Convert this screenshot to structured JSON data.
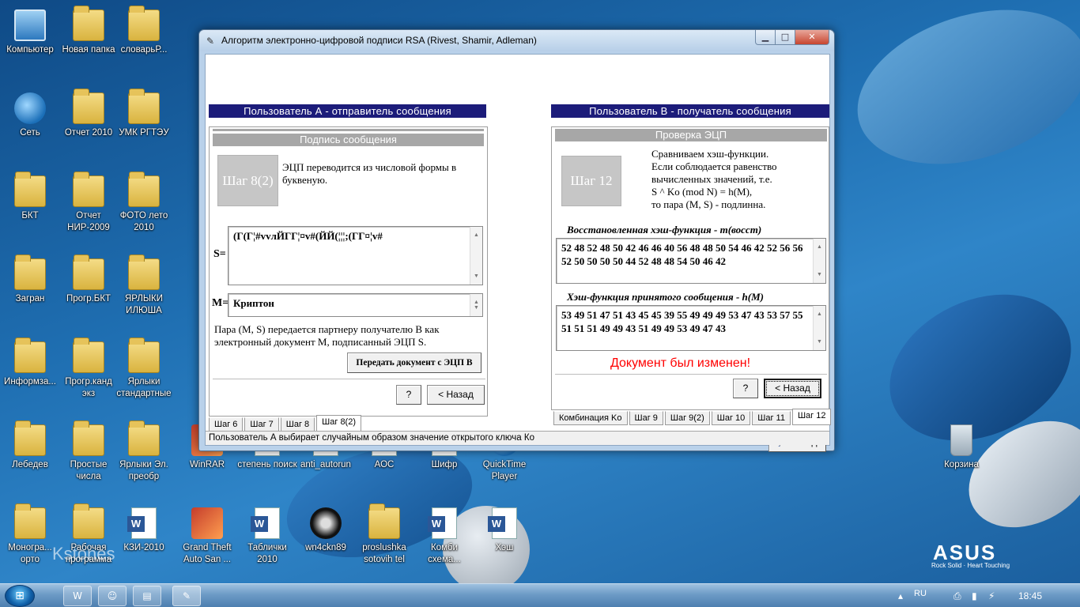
{
  "desktop": {
    "icons": [
      {
        "label": "Компьютер",
        "icon": "computer-icon"
      },
      {
        "label": "Новая папка",
        "icon": "folder-icon"
      },
      {
        "label": "словарьР...",
        "icon": "folder-icon"
      },
      {
        "label": "Сеть",
        "icon": "network-icon"
      },
      {
        "label": "Отчет 2010",
        "icon": "folder-icon"
      },
      {
        "label": "УМК РГТЭУ",
        "icon": "folder-icon"
      },
      {
        "label": "БКТ",
        "icon": "folder-icon"
      },
      {
        "label": "Отчет НИР-2009",
        "icon": "folder-icon"
      },
      {
        "label": "ФОТО лето 2010",
        "icon": "folder-icon"
      },
      {
        "label": "Загран",
        "icon": "folder-icon"
      },
      {
        "label": "Прогр.БКТ",
        "icon": "folder-icon"
      },
      {
        "label": "ЯРЛЫКИ ИЛЮША",
        "icon": "folder-icon"
      },
      {
        "label": "Информза...",
        "icon": "folder-icon"
      },
      {
        "label": "Прогр.канд экз",
        "icon": "folder-icon"
      },
      {
        "label": "Ярлыки стандартные",
        "icon": "folder-icon"
      },
      {
        "label": "Лебедев",
        "icon": "folder-icon"
      },
      {
        "label": "Простые числа",
        "icon": "folder-icon"
      },
      {
        "label": "Ярлыки Эл. преобр",
        "icon": "folder-icon"
      },
      {
        "label": "Моногра... орто",
        "icon": "folder-icon"
      },
      {
        "label": "Рабочая программа",
        "icon": "folder-icon"
      },
      {
        "label": "КЗИ-2010",
        "icon": "word-doc-icon"
      },
      {
        "label": "Grand Theft Auto San ...",
        "icon": "game-icon"
      },
      {
        "label": "Таблички 2010",
        "icon": "word-doc-icon"
      },
      {
        "label": "wn4ckn89",
        "icon": "spider-icon"
      },
      {
        "label": "proslushka sotovih tel",
        "icon": "folder-icon"
      },
      {
        "label": "Комби схема...",
        "icon": "word-doc-icon"
      },
      {
        "label": "Хэш",
        "icon": "word-doc-icon"
      },
      {
        "label": "WinRAR",
        "icon": "winrar-icon"
      },
      {
        "label": "степень поиск",
        "icon": "doc-icon"
      },
      {
        "label": "anti_autorun",
        "icon": "doc-icon"
      },
      {
        "label": "АОС",
        "icon": "doc-icon"
      },
      {
        "label": "Шифр",
        "icon": "doc-icon"
      },
      {
        "label": "QuickTime Player",
        "icon": "quicktime-icon"
      },
      {
        "label": "Корзина",
        "icon": "trash-icon"
      }
    ],
    "watermark": "Kstones",
    "brand": "ASUS",
    "brand_tagline": "Rock Solid · Heart Touching"
  },
  "window": {
    "title": "Алгоритм электронно-цифровой подписи RSA (Rivest, Shamir, Adleman)",
    "status": "Пользователь А выбирает случайным образом значение открытого ключа Ко",
    "left": {
      "header": "Пользователь А - отправитель сообщения",
      "panel_title": "Подпись сообщения",
      "step": "Шаг 8(2)",
      "step_text": "ЭЦП переводится из числовой формы в буквеную.",
      "s_label": "S=",
      "s_value": "(Г(Г¦#vvлЙГГ¦¤v#(ЙЙ(¦¦¦;(ГГ¤¦v#",
      "m_label": "M=",
      "m_value": "Криптон",
      "note": "Пара (M, S) передается партнеру получателю В как электронный документ М, подписанный ЭЦП S.",
      "send_button": "Передать документ с ЭЦП В",
      "help_button": "?",
      "back_button": "< Назад",
      "tabs": [
        "Шаг 6",
        "Шаг 7",
        "Шаг 8",
        "Шаг 8(2)"
      ],
      "active_tab": "Шаг 8(2)"
    },
    "right": {
      "header": "Пользователь В - получатель сообщения",
      "panel_title": "Проверка ЭЦП",
      "step": "Шаг 12",
      "step_text_lines": [
        "Сравниваем хэш-функции.",
        "Если соблюдается равенство",
        "вычисленных значений, т.е.",
        "S ^ Ko (mod N) = h(M),",
        "то пара (M, S) - подлинна."
      ],
      "restored_label": "Восстановленная хэш-функция - m(восст)",
      "restored_value": "52 48 52 48 50 42 46 46 40 56 48 48 50 54 46 42 52 56 56 52 50 50 50 50 44 52 48 48 54 50 46 42",
      "received_label": "Хэш-функция принятого сообщения - h(M)",
      "received_value": "53 49 51 47 51 43 45 45 39 55 49 49 49 53 47 43 53 57 55 51 51 51 49 49 43 51 49 49 53 49 47 43",
      "result": "Документ был изменен!",
      "help_button": "?",
      "back_button": "< Назад",
      "tabs": [
        "Комбинация Ko",
        "Шаг 9",
        "Шаг 9(2)",
        "Шаг 10",
        "Шаг 11",
        "Шаг 12"
      ],
      "active_tab": "Шаг 12",
      "exit_button": "Выход"
    }
  },
  "taskbar": {
    "language": "RU",
    "clock": "18:45"
  }
}
